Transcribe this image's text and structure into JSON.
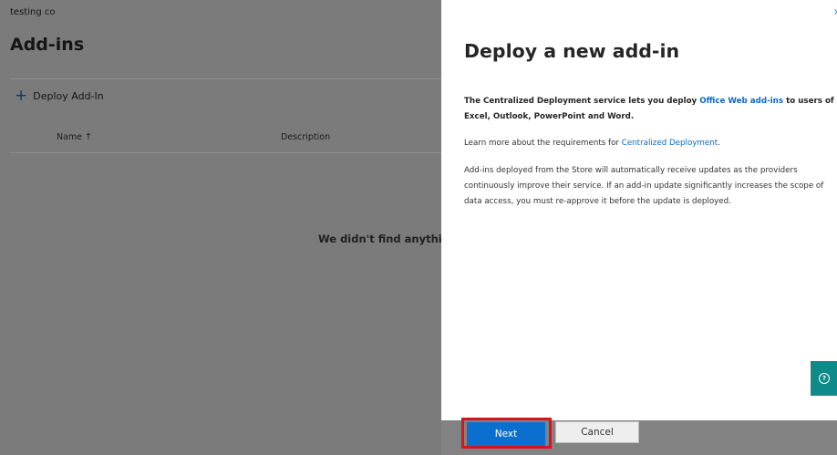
{
  "org_name": "testing co",
  "page": {
    "title": "Add-ins",
    "deploy_addin_label": "Deploy Add-In",
    "columns": {
      "name": "Name ↑",
      "description": "Description"
    },
    "empty_message": "We didn't find anything"
  },
  "panel": {
    "close_glyph": "×",
    "title": "Deploy a new add-in",
    "para1_before": "The Centralized Deployment service lets you deploy ",
    "para1_link": "Office Web add-ins",
    "para1_after": " to users of Excel, Outlook, PowerPoint and Word.",
    "para2_before": "Learn more about the requirements for ",
    "para2_link": "Centralized Deployment",
    "para2_after": ".",
    "para3": "Add-ins deployed from the Store will automatically receive updates as the providers continuously improve their service. If an add-in update significantly increases the scope of data access, you must re-approve it before the update is deployed.",
    "help_glyph": "?"
  },
  "footer": {
    "next_label": "Next",
    "cancel_label": "Cancel"
  },
  "colors": {
    "primary": "#0a6fcf",
    "link": "#0b6ac4",
    "highlight": "#d7131d",
    "help": "#0d8a89"
  }
}
